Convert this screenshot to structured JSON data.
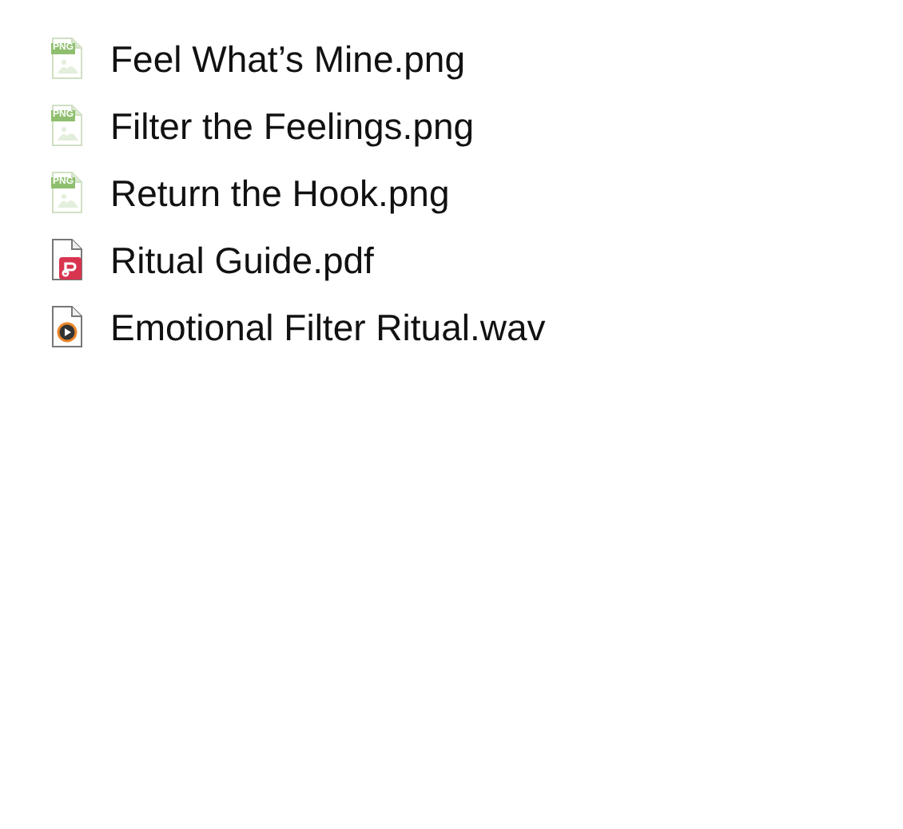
{
  "files": [
    {
      "name": "Feel What’s Mine.png",
      "kind": "png",
      "badge": "PNG"
    },
    {
      "name": "Filter the Feelings.png",
      "kind": "png",
      "badge": "PNG"
    },
    {
      "name": "Return the Hook.png",
      "kind": "png",
      "badge": "PNG"
    },
    {
      "name": "Ritual Guide.pdf",
      "kind": "pdf"
    },
    {
      "name": "Emotional Filter Ritual.wav",
      "kind": "wav"
    }
  ]
}
